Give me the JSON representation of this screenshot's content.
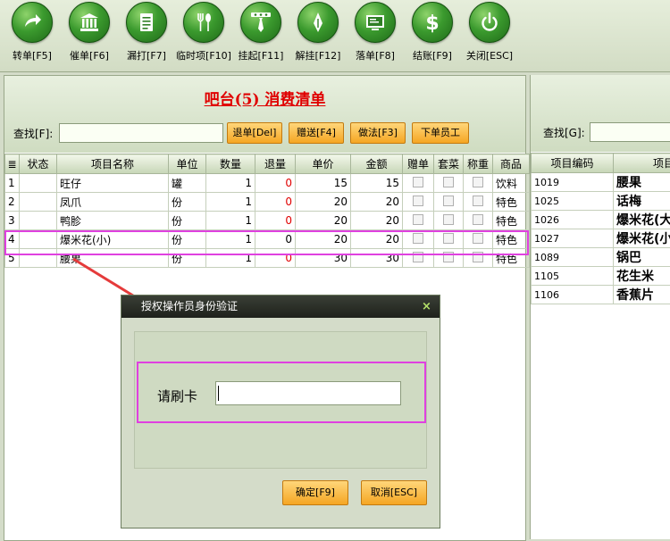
{
  "toolbar": {
    "buttons": [
      {
        "label": "转单[F5]",
        "icon": "forward-arrow-icon"
      },
      {
        "label": "催单[F6]",
        "icon": "bank-icon"
      },
      {
        "label": "漏打[F7]",
        "icon": "document-icon"
      },
      {
        "label": "临时项[F10]",
        "icon": "fork-spoon-icon"
      },
      {
        "label": "挂起[F11]",
        "icon": "tie-icon"
      },
      {
        "label": "解挂[F12]",
        "icon": "pen-nib-icon"
      },
      {
        "label": "落单[F8]",
        "icon": "monitor-icon"
      },
      {
        "label": "结账[F9]",
        "icon": "dollar-icon"
      },
      {
        "label": "关闭[ESC]",
        "icon": "power-icon"
      }
    ]
  },
  "order": {
    "title": "吧台(5)  消费清单",
    "search_label": "查找[F]:",
    "search_value": "",
    "actions": [
      "退单[Del]",
      "赠送[F4]",
      "做法[F3]",
      "下单员工"
    ],
    "columns": [
      "≣",
      "状态",
      "项目名称",
      "单位",
      "数量",
      "退量",
      "单价",
      "金额",
      "赠单",
      "套菜",
      "称重",
      "商品"
    ],
    "rows": [
      {
        "no": "1",
        "status": "",
        "name": "旺仔",
        "unit": "罐",
        "qty": "1",
        "ret": "0",
        "price": "15",
        "amount": "15",
        "cat": "饮料"
      },
      {
        "no": "2",
        "status": "",
        "name": "凤爪",
        "unit": "份",
        "qty": "1",
        "ret": "0",
        "price": "20",
        "amount": "20",
        "cat": "特色"
      },
      {
        "no": "3",
        "status": "",
        "name": "鸭胗",
        "unit": "份",
        "qty": "1",
        "ret": "0",
        "price": "20",
        "amount": "20",
        "cat": "特色"
      },
      {
        "no": "4",
        "status": "",
        "name": "爆米花(小)",
        "unit": "份",
        "qty": "1",
        "ret": "0",
        "price": "20",
        "amount": "20",
        "cat": "特色"
      },
      {
        "no": "5",
        "status": "",
        "name": "腰果",
        "unit": "份",
        "qty": "1",
        "ret": "0",
        "price": "30",
        "amount": "30",
        "cat": "特色"
      }
    ]
  },
  "menu": {
    "search_label": "查找[G]:",
    "search_value": "",
    "columns": [
      "项目编码",
      "项目"
    ],
    "rows": [
      {
        "code": "1019",
        "name": "腰果"
      },
      {
        "code": "1025",
        "name": "话梅"
      },
      {
        "code": "1026",
        "name": "爆米花(大"
      },
      {
        "code": "1027",
        "name": "爆米花(小"
      },
      {
        "code": "1089",
        "name": "锅巴"
      },
      {
        "code": "1105",
        "name": "花生米"
      },
      {
        "code": "1106",
        "name": "香蕉片"
      }
    ]
  },
  "dialog": {
    "title": "授权操作员身份验证",
    "close": "×",
    "card_label": "请刷卡",
    "card_value": "",
    "ok": "确定[F9]",
    "cancel": "取消[ESC]"
  },
  "colors": {
    "accent": "#3b9a2e",
    "title_red": "#e00000",
    "highlight": "#e040e0",
    "button_orange": "#f5a623"
  }
}
